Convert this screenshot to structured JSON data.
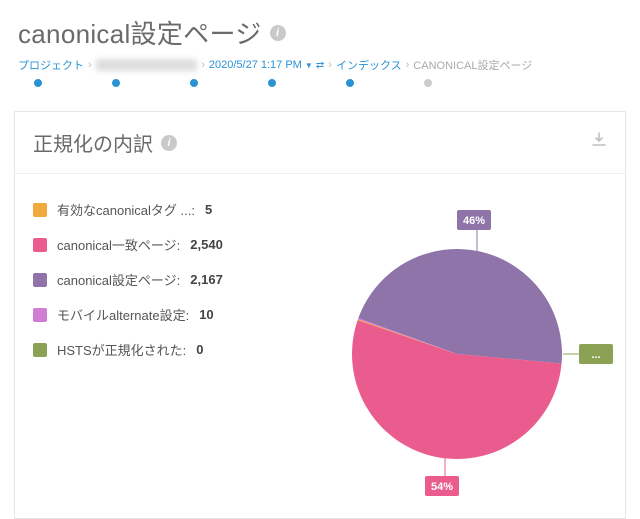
{
  "header": {
    "title": "canonical設定ページ"
  },
  "breadcrumb": {
    "items": [
      {
        "label": "プロジェクト",
        "link": true
      },
      {
        "label": "████████████",
        "blur": true,
        "link": true
      },
      {
        "label": "2020/5/27 1:17 PM",
        "link": true,
        "dropdown": true,
        "swap": true
      },
      {
        "label": "インデックス",
        "link": true
      },
      {
        "label": "CANONICAL設定ページ",
        "link": false
      }
    ]
  },
  "card": {
    "title": "正規化の内訳",
    "legend": [
      {
        "label": "有効なcanonicalタグ ...:",
        "value": "5",
        "color": "#f0a93c"
      },
      {
        "label": "canonical一致ページ:",
        "value": "2,540",
        "color": "#eb5c8e"
      },
      {
        "label": "canonical設定ページ:",
        "value": "2,167",
        "color": "#8e74a8"
      },
      {
        "label": "モバイルalternate設定:",
        "value": "10",
        "color": "#d07dd4"
      },
      {
        "label": "HSTSが正規化された:",
        "value": "0",
        "color": "#8ba154"
      }
    ]
  },
  "chart_data": {
    "type": "pie",
    "title": "正規化の内訳",
    "series": [
      {
        "name": "有効なcanonicalタグ",
        "value": 5,
        "color": "#f0a93c",
        "percent_label": null
      },
      {
        "name": "canonical一致ページ",
        "value": 2540,
        "color": "#eb5c8e",
        "percent_label": "54%"
      },
      {
        "name": "canonical設定ページ",
        "value": 2167,
        "color": "#8e74a8",
        "percent_label": "46%"
      },
      {
        "name": "モバイルalternate設定",
        "value": 10,
        "color": "#d07dd4",
        "percent_label": null
      },
      {
        "name": "HSTSが正規化された",
        "value": 0,
        "color": "#8ba154",
        "percent_label": "..."
      }
    ]
  }
}
